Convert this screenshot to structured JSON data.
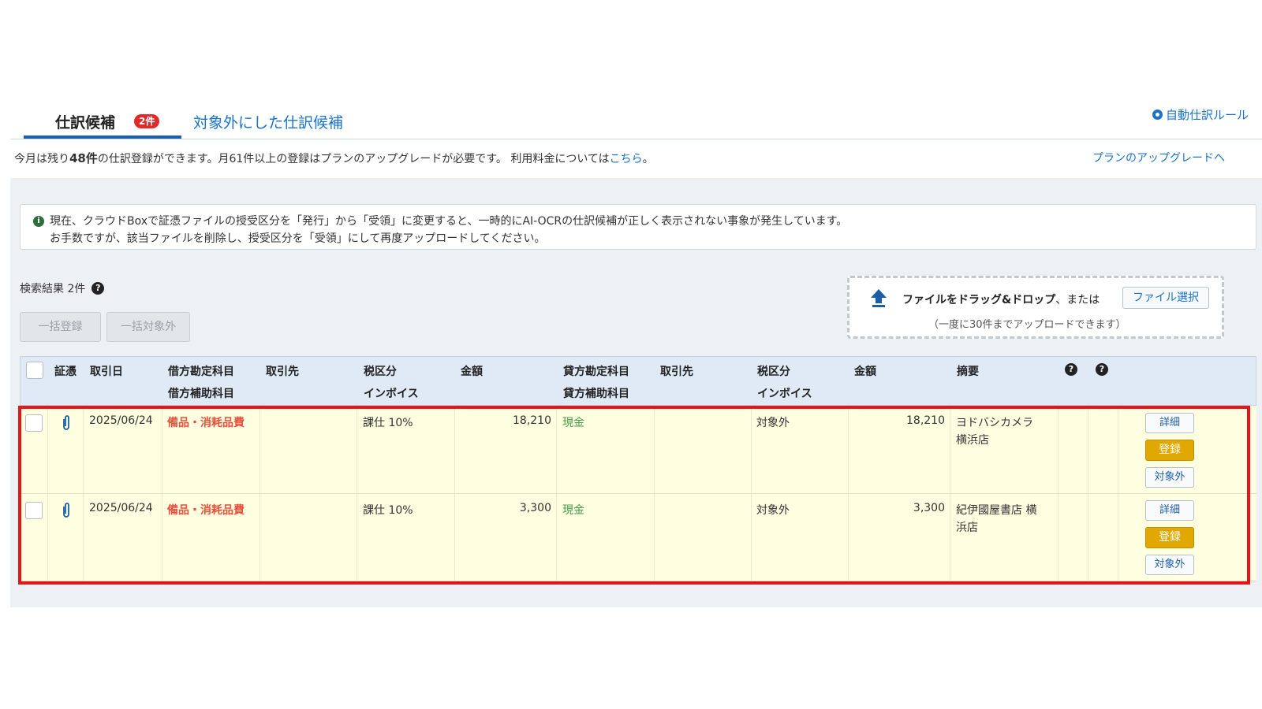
{
  "tabs": {
    "active_label": "仕訳候補",
    "active_badge": "2件",
    "second_label": "対象外にした仕訳候補",
    "auto_rule": "自動仕訳ルール"
  },
  "quota": {
    "prefix": "今月は残り",
    "remaining": "48件",
    "middle": "の仕訳登録ができます。月61件以上の登録はプランのアップグレードが必要です。 利用料金については",
    "link": "こちら",
    "suffix": "。",
    "upgrade_link": "プランのアップグレードへ"
  },
  "notice": {
    "line1": "現在、クラウドBoxで証憑ファイルの授受区分を「発行」から「受領」に変更すると、一時的にAI-OCRの仕訳候補が正しく表示されない事象が発生しています。",
    "line2": "お手数ですが、該当ファイルを削除し、授受区分を「受領」にして再度アップロードしてください。"
  },
  "results": {
    "count_label": "検索結果 2件",
    "bulk_register": "一括登録",
    "bulk_exclude": "一括対象外"
  },
  "upload": {
    "drag_text_bold": "ファイルをドラッグ&ドロップ",
    "drag_text_rest": "、または",
    "file_button": "ファイル選択",
    "limit": "（一度に30件までアップロードできます）"
  },
  "table": {
    "headers": {
      "voucher": "証憑",
      "date": "取引日",
      "debit_account": "借方勘定科目",
      "debit_sub": "借方補助科目",
      "debit_partner": "取引先",
      "debit_tax": "税区分",
      "debit_invoice": "インボイス",
      "debit_amount": "金額",
      "credit_account": "貸方勘定科目",
      "credit_sub": "貸方補助科目",
      "credit_partner": "取引先",
      "credit_tax": "税区分",
      "credit_invoice": "インボイス",
      "credit_amount": "金額",
      "memo": "摘要"
    },
    "rows": [
      {
        "date": "2025/06/24",
        "debit_account": "備品・消耗品費",
        "debit_tax": "課仕 10%",
        "debit_amount": "18,210",
        "credit_account": "現金",
        "credit_tax": "対象外",
        "credit_amount": "18,210",
        "memo_line1": "ヨドバシカメラ",
        "memo_line2": "横浜店",
        "detail": "詳細",
        "register": "登録",
        "exclude": "対象外"
      },
      {
        "date": "2025/06/24",
        "debit_account": "備品・消耗品費",
        "debit_tax": "課仕 10%",
        "debit_amount": "3,300",
        "credit_account": "現金",
        "credit_tax": "対象外",
        "credit_amount": "3,300",
        "memo_line1": "紀伊國屋書店 横",
        "memo_line2": "浜店",
        "detail": "詳細",
        "register": "登録",
        "exclude": "対象外"
      }
    ]
  },
  "icons": [
    "info-icon",
    "help-icon",
    "upload-arrow-icon",
    "paperclip-icon",
    "auto-rule-icon"
  ],
  "colors": {
    "accent": "#1a73c9",
    "register": "#e0a800",
    "highlight_frame": "#e3161c",
    "row_bg": "#fefee0"
  }
}
